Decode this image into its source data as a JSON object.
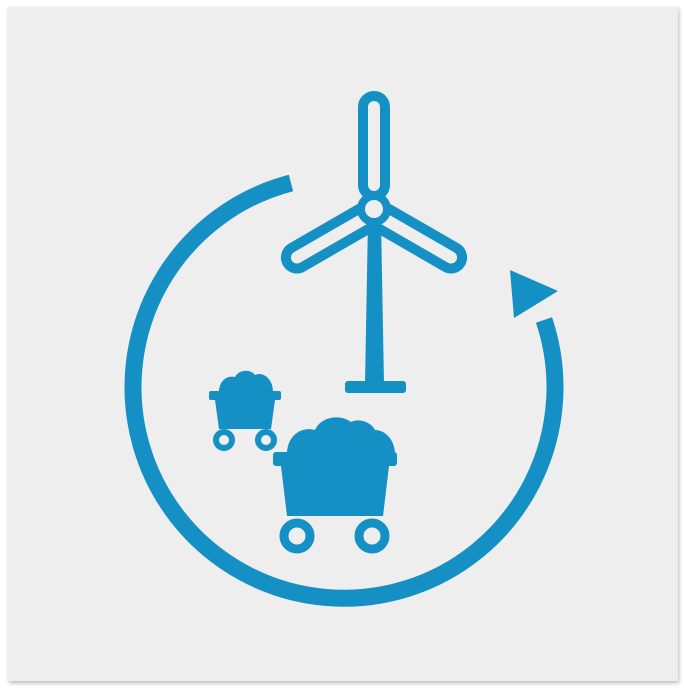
{
  "illustration": {
    "icons": [
      "cycle-arrow-icon",
      "wind-turbine-icon",
      "mine-cart-icon"
    ],
    "colors": {
      "background": "#eeeeee",
      "accent": "#1590c4"
    }
  }
}
